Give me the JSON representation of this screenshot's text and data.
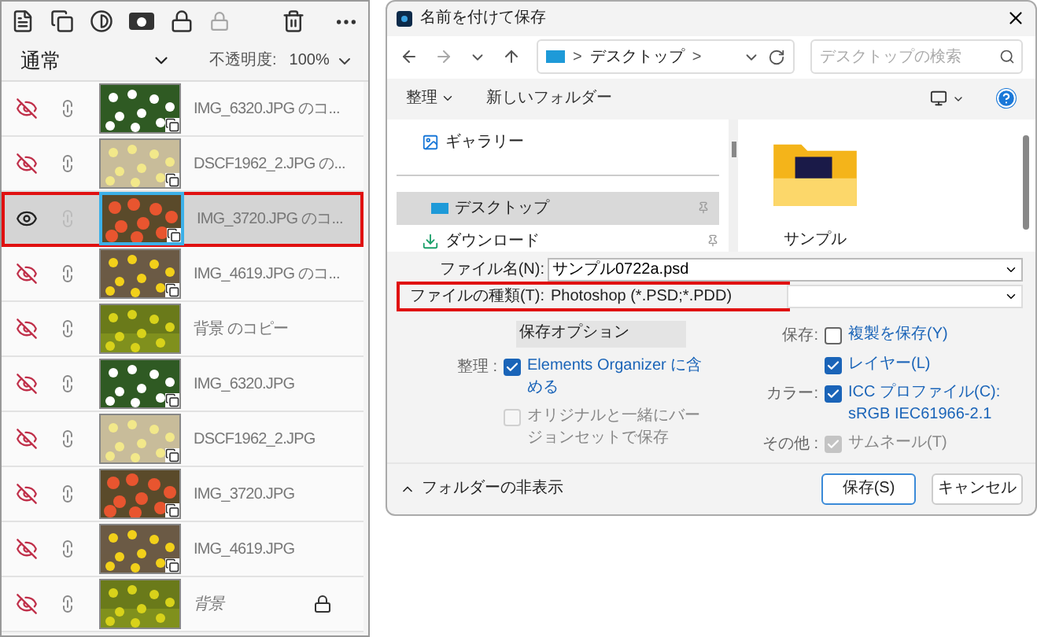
{
  "layers_panel": {
    "blend_mode": "通常",
    "opacity_label": "不透明度:",
    "opacity_value": "100%",
    "layers": [
      {
        "name": "IMG_6320.JPG のコ...",
        "kind": "smart",
        "visible": false,
        "selected": false
      },
      {
        "name": "DSCF1962_2.JPG の...",
        "kind": "smart",
        "visible": false,
        "selected": false
      },
      {
        "name": "IMG_3720.JPG のコ...",
        "kind": "smart",
        "visible": true,
        "selected": true
      },
      {
        "name": "IMG_4619.JPG のコ...",
        "kind": "smart",
        "visible": false,
        "selected": false
      },
      {
        "name": "背景 のコピー",
        "kind": "normal",
        "visible": false,
        "selected": false
      },
      {
        "name": "IMG_6320.JPG",
        "kind": "smart",
        "visible": false,
        "selected": false
      },
      {
        "name": "DSCF1962_2.JPG",
        "kind": "smart",
        "visible": false,
        "selected": false
      },
      {
        "name": "IMG_3720.JPG",
        "kind": "smart",
        "visible": false,
        "selected": false
      },
      {
        "name": "IMG_4619.JPG",
        "kind": "smart",
        "visible": false,
        "selected": false
      },
      {
        "name": "背景",
        "kind": "background",
        "visible": false,
        "selected": false
      }
    ]
  },
  "dialog": {
    "title": "名前を付けて保存",
    "breadcrumb": "デスクトップ",
    "breadcrumb_sep": ">",
    "search_placeholder": "デスクトップの検索",
    "toolbar": {
      "organize": "整理",
      "new_folder": "新しいフォルダー"
    },
    "nav_items": [
      {
        "label": "ギャラリー",
        "kind": "gallery",
        "selected": false
      },
      {
        "label": "デスクトップ",
        "kind": "desktop",
        "selected": true
      },
      {
        "label": "ダウンロード",
        "kind": "download",
        "selected": false
      }
    ],
    "folders": [
      {
        "name": "サンプル"
      }
    ],
    "file_name": {
      "label": "ファイル名(N):",
      "value": "サンプル0722a.psd"
    },
    "file_type": {
      "label": "ファイルの種類(T):",
      "value": "Photoshop (*.PSD;*.PDD)",
      "highlighted": true
    },
    "save_options_title": "保存オプション",
    "left_options": [
      {
        "group": "整理 :",
        "label": "Elements Organizer に含める",
        "checked": true,
        "disabled": false
      },
      {
        "label": "オリジナルと一緒にバージョンセットで保存",
        "checked": false,
        "disabled": true
      }
    ],
    "right_options": [
      {
        "group": "保存:",
        "label": "複製を保存(Y)",
        "checked": false,
        "disabled": false
      },
      {
        "label": "レイヤー(L)",
        "checked": true,
        "disabled": false
      },
      {
        "group": "カラー:",
        "label": "ICC プロファイル(C): sRGB IEC61966-2.1",
        "checked": true,
        "disabled": false
      },
      {
        "group": "その他 :",
        "label": "サムネール(T)",
        "checked": true,
        "disabled": true
      }
    ],
    "hide_folders": "フォルダーの非表示",
    "save_button": "保存(S)",
    "cancel_button": "キャンセル"
  }
}
